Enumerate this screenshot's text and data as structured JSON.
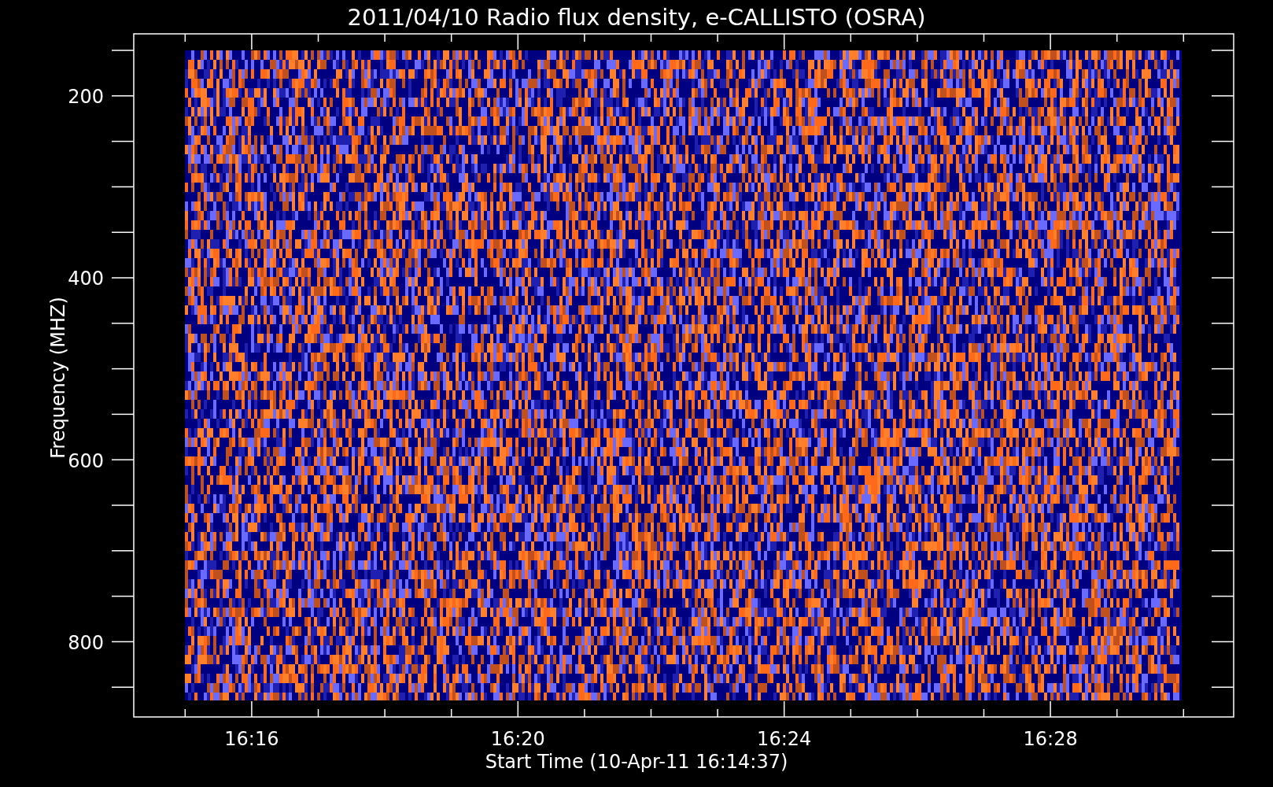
{
  "title": "2011/04/10  Radio flux density, e-CALLISTO (OSRA)",
  "y_axis": {
    "label": "Frequency (MHZ)",
    "tick_labels": [
      "200",
      "400",
      "600",
      "800"
    ]
  },
  "x_axis": {
    "label": "Start Time (10-Apr-11 16:14:37)",
    "tick_labels": [
      "16:16",
      "16:20",
      "16:24",
      "16:28"
    ]
  },
  "image": {
    "kind": "spectrogram"
  }
}
